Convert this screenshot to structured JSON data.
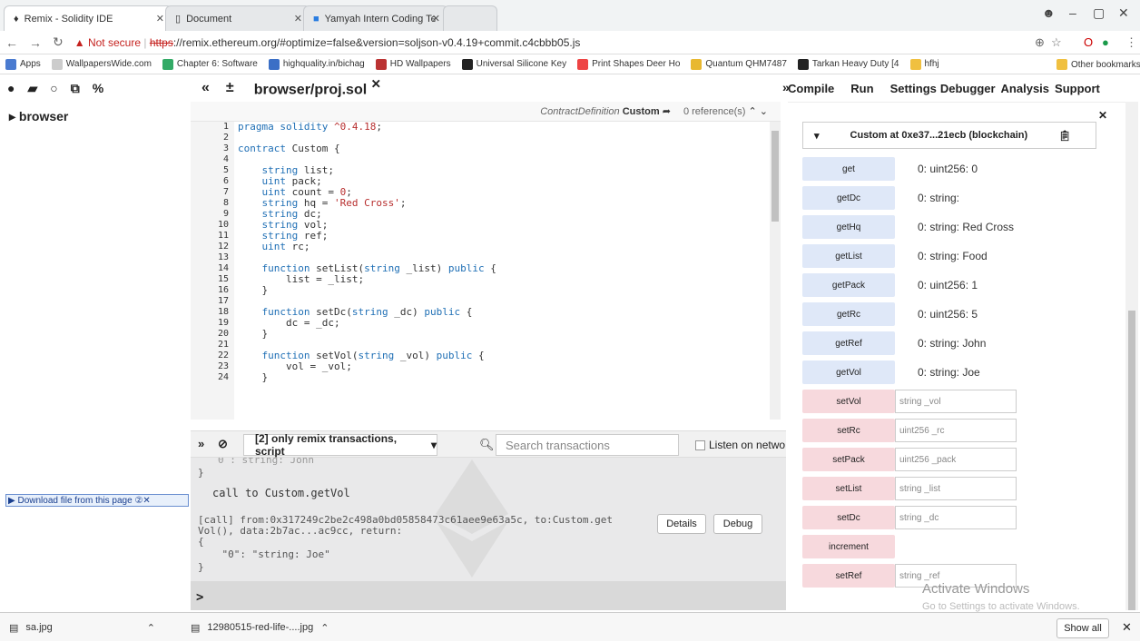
{
  "browser": {
    "tabs": [
      {
        "title": "Remix - Solidity IDE",
        "active": true
      },
      {
        "title": "Document",
        "active": false
      },
      {
        "title": "Yamyah Intern Coding Te",
        "active": false
      }
    ],
    "url": {
      "warning": "Not secure",
      "scheme": "https",
      "rest": "://remix.ethereum.org/#optimize=false&version=soljson-v0.4.19+commit.c4cbbb05.js"
    },
    "bookmarks": [
      "Apps",
      "WallpapersWide.com",
      "Chapter 6: Software",
      "highquality.in/bichag",
      "HD Wallpapers",
      "Universal Silicone Key",
      "Print Shapes Deer Ho",
      "Quantum QHM7487",
      "Tarkan Heavy Duty [4",
      "hfhj"
    ],
    "other_bookmarks": "Other bookmarks"
  },
  "remix": {
    "filetree_root": "browser",
    "file_tab": "browser/proj.sol",
    "contract_definition_label": "ContractDefinition",
    "contract_name": "Custom",
    "references": "0 reference(s)",
    "line_numbers": [
      "1",
      "2",
      "3",
      "4",
      "5",
      "6",
      "7",
      "8",
      "9",
      "10",
      "11",
      "12",
      "13",
      "14",
      "15",
      "16",
      "17",
      "18",
      "19",
      "20",
      "21",
      "22",
      "23",
      "24"
    ],
    "code_lines": [
      "pragma solidity ^0.4.18;",
      "",
      "contract Custom {",
      "",
      "    string list;",
      "    uint pack;",
      "    uint count = 0;",
      "    string hq = 'Red Cross';",
      "    string dc;",
      "    string vol;",
      "    string ref;",
      "    uint rc;",
      "",
      "    function setList(string _list) public {",
      "        list = _list;",
      "    }",
      "",
      "    function setDc(string _dc) public {",
      "        dc = _dc;",
      "    }",
      "",
      "    function setVol(string _vol) public {",
      "        vol = _vol;",
      "    }"
    ],
    "terminal": {
      "filter": "[2] only remix transactions, script",
      "search_placeholder": "Search transactions",
      "listen_label": "Listen on netwo",
      "line_top": "0 : string: John",
      "line_brace": "}",
      "line_call": "call to Custom.getVol",
      "line_tx1": "[call] from:0x317249c2be2c498a0bd05858473c61aee9e63a5c, to:Custom.get",
      "line_tx2": "Vol(), data:2b7ac...ac9cc, return:",
      "line_open": "{",
      "line_val": "    \"0\": \"string: Joe\"",
      "line_close": "}",
      "details_btn": "Details",
      "debug_btn": "Debug",
      "prompt": ">"
    },
    "download_helper": "Download file from this page",
    "right_tabs": [
      "Compile",
      "Run",
      "Settings",
      "Debugger",
      "Analysis",
      "Support"
    ],
    "instance_title": "Custom at 0xe37...21ecb (blockchain)",
    "calls": [
      {
        "name": "get",
        "value": "0: uint256: 0"
      },
      {
        "name": "getDc",
        "value": "0: string:"
      },
      {
        "name": "getHq",
        "value": "0: string: Red Cross"
      },
      {
        "name": "getList",
        "value": "0: string: Food"
      },
      {
        "name": "getPack",
        "value": "0: uint256: 1"
      },
      {
        "name": "getRc",
        "value": "0: uint256: 5"
      },
      {
        "name": "getRef",
        "value": "0: string: John"
      },
      {
        "name": "getVol",
        "value": "0: string: Joe"
      }
    ],
    "transactions": [
      {
        "name": "setVol",
        "placeholder": "string _vol"
      },
      {
        "name": "setRc",
        "placeholder": "uint256 _rc"
      },
      {
        "name": "setPack",
        "placeholder": "uint256 _pack"
      },
      {
        "name": "setList",
        "placeholder": "string _list"
      },
      {
        "name": "setDc",
        "placeholder": "string _dc"
      },
      {
        "name": "increment",
        "placeholder": ""
      },
      {
        "name": "setRef",
        "placeholder": "string _ref"
      }
    ],
    "watermark_title": "Activate Windows",
    "watermark_sub": "Go to Settings to activate Windows."
  },
  "downloads": {
    "items": [
      "sa.jpg",
      "12980515-red-life-....jpg"
    ],
    "show_all": "Show all"
  }
}
